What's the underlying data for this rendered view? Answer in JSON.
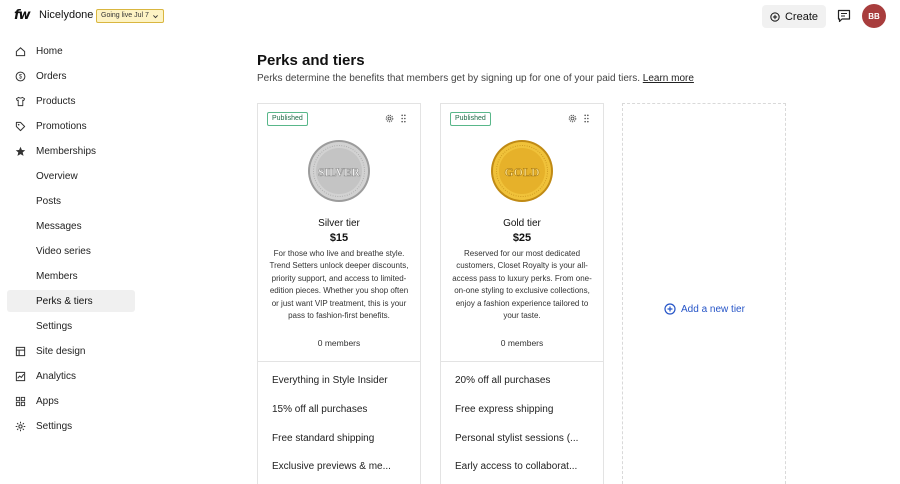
{
  "topbar": {
    "logo": "fw",
    "brand": "Nicelydone",
    "live_badge": "Going live Jul 7",
    "create_label": "Create",
    "avatar_initials": "BB"
  },
  "sidebar": {
    "items": [
      {
        "label": "Home",
        "icon": "home-icon"
      },
      {
        "label": "Orders",
        "icon": "orders-icon"
      },
      {
        "label": "Products",
        "icon": "products-icon"
      },
      {
        "label": "Promotions",
        "icon": "tag-icon"
      },
      {
        "label": "Memberships",
        "icon": "star-icon"
      },
      {
        "label": "Overview"
      },
      {
        "label": "Posts"
      },
      {
        "label": "Messages"
      },
      {
        "label": "Video series"
      },
      {
        "label": "Members"
      },
      {
        "label": "Perks & tiers",
        "active": true
      },
      {
        "label": "Settings"
      },
      {
        "label": "Site design",
        "icon": "site-design-icon"
      },
      {
        "label": "Analytics",
        "icon": "analytics-icon"
      },
      {
        "label": "Apps",
        "icon": "apps-icon"
      },
      {
        "label": "Settings",
        "icon": "gear-icon"
      }
    ]
  },
  "main": {
    "title": "Perks and tiers",
    "subtitle": "Perks determine the benefits that members get by signing up for one of your paid tiers.",
    "learn_more": "Learn more",
    "add_tier_label": "Add a new tier"
  },
  "tiers": [
    {
      "status": "Published",
      "medal_text": "SILVER",
      "name": "Silver tier",
      "price": "$15",
      "description": "For those who live and breathe style. Trend Setters unlock deeper discounts, priority support, and access to limited-edition pieces. Whether you shop often or just want VIP treatment, this is your pass to fashion-first benefits.",
      "members": "0 members",
      "perks": [
        "Everything in Style Insider",
        "15% off all purchases",
        "Free standard shipping",
        "Exclusive previews & me..."
      ]
    },
    {
      "status": "Published",
      "medal_text": "GOLD",
      "name": "Gold tier",
      "price": "$25",
      "description": "Reserved for our most dedicated customers, Closet Royalty is your all-access pass to luxury perks. From one-on-one styling to exclusive collections, enjoy a fashion experience tailored to your taste.",
      "members": "0 members",
      "perks": [
        "20% off all purchases",
        "Free express shipping",
        "Personal stylist sessions (...",
        "Early access to collaborat..."
      ]
    }
  ],
  "colors": {
    "avatar_bg": "#a83d3d",
    "badge_border": "#59b78a",
    "live_badge_bg": "#fdf3c4",
    "link_blue": "#2554c7"
  }
}
